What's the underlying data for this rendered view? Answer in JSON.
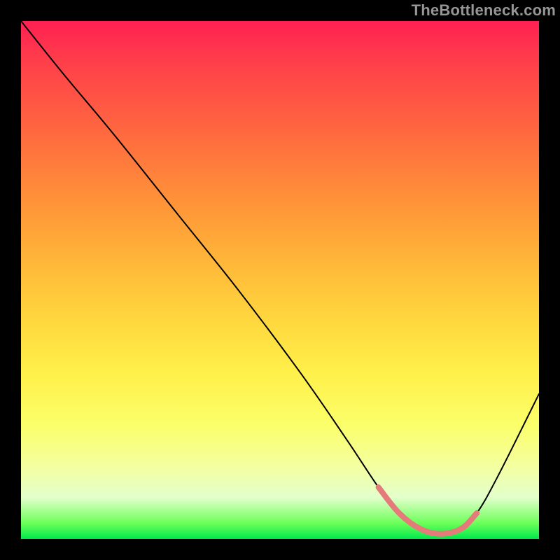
{
  "watermark": {
    "text": "TheBottleneck.com"
  },
  "chart_data": {
    "type": "line",
    "title": "",
    "xlabel": "",
    "ylabel": "",
    "xlim": [
      0,
      100
    ],
    "ylim": [
      0,
      100
    ],
    "grid": false,
    "legend": false,
    "series": [
      {
        "name": "bottleneck-curve",
        "color": "#000000",
        "width": 2,
        "x": [
          0,
          8,
          18,
          30,
          42,
          54,
          63,
          69,
          73,
          77,
          81,
          85,
          88,
          92,
          100
        ],
        "values": [
          100,
          90,
          78,
          63,
          48,
          32,
          19,
          10,
          5,
          2,
          1,
          2,
          5,
          12,
          28
        ]
      },
      {
        "name": "highlight-band",
        "color": "#e47a79",
        "width": 8,
        "x": [
          69,
          73,
          77,
          81,
          85,
          88
        ],
        "values": [
          10,
          5,
          2,
          1,
          2,
          5
        ]
      }
    ],
    "annotations": [
      {
        "text": "TheBottleneck.com",
        "pos": "top-right",
        "color": "#969696"
      }
    ]
  },
  "colors": {
    "background": "#000000",
    "watermark": "#969696",
    "curve": "#000000",
    "highlight": "#e47a79"
  }
}
